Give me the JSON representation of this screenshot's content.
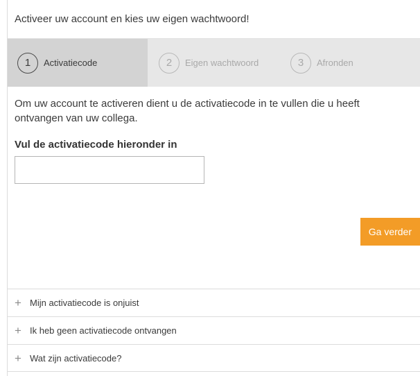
{
  "header": {
    "title": "Activeer uw account en kies uw eigen wachtwoord!"
  },
  "steps": [
    {
      "number": "1",
      "label": "Activatiecode",
      "active": true
    },
    {
      "number": "2",
      "label": "Eigen wachtwoord",
      "active": false
    },
    {
      "number": "3",
      "label": "Afronden",
      "active": false
    }
  ],
  "main": {
    "intro": "Om uw account te activeren dient u de activatiecode in te vullen die u heeft ontvangen van uw collega.",
    "field_label": "Vul de activatiecode hieronder in",
    "code_value": "",
    "continue_label": "Ga verder"
  },
  "faq": [
    {
      "label": "Mijn activatiecode is onjuist"
    },
    {
      "label": "Ik heb geen activatiecode ontvangen"
    },
    {
      "label": "Wat zijn activatiecode?"
    }
  ],
  "colors": {
    "accent": "#f39c27",
    "step_active_bg": "#d3d3d3",
    "steps_bg": "#e7e7e7"
  }
}
